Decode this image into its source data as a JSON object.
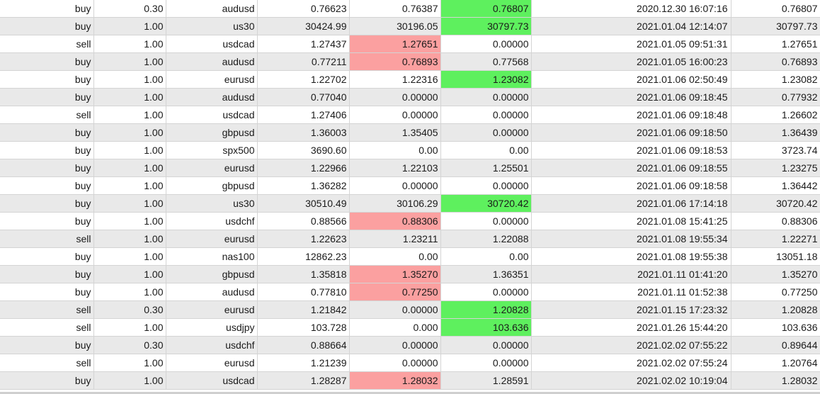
{
  "colors": {
    "stop_loss_hit": "#fba0a0",
    "take_profit_hit": "#5ef05e",
    "row_alt": "#e9e9e9",
    "row": "#ffffff",
    "grid_line": "#d4d4d4"
  },
  "rows": [
    {
      "type": "buy",
      "volume": "0.30",
      "symbol": "audusd",
      "open_price": "0.76623",
      "stop_loss": "0.76387",
      "take_profit": "0.76807",
      "close_time": "2020.12.30 16:07:16",
      "close_price": "0.76807",
      "sl_hit": false,
      "tp_hit": true
    },
    {
      "type": "buy",
      "volume": "1.00",
      "symbol": "us30",
      "open_price": "30424.99",
      "stop_loss": "30196.05",
      "take_profit": "30797.73",
      "close_time": "2021.01.04 12:14:07",
      "close_price": "30797.73",
      "sl_hit": false,
      "tp_hit": true
    },
    {
      "type": "sell",
      "volume": "1.00",
      "symbol": "usdcad",
      "open_price": "1.27437",
      "stop_loss": "1.27651",
      "take_profit": "0.00000",
      "close_time": "2021.01.05 09:51:31",
      "close_price": "1.27651",
      "sl_hit": true,
      "tp_hit": false
    },
    {
      "type": "buy",
      "volume": "1.00",
      "symbol": "audusd",
      "open_price": "0.77211",
      "stop_loss": "0.76893",
      "take_profit": "0.77568",
      "close_time": "2021.01.05 16:00:23",
      "close_price": "0.76893",
      "sl_hit": true,
      "tp_hit": false
    },
    {
      "type": "buy",
      "volume": "1.00",
      "symbol": "eurusd",
      "open_price": "1.22702",
      "stop_loss": "1.22316",
      "take_profit": "1.23082",
      "close_time": "2021.01.06 02:50:49",
      "close_price": "1.23082",
      "sl_hit": false,
      "tp_hit": true
    },
    {
      "type": "buy",
      "volume": "1.00",
      "symbol": "audusd",
      "open_price": "0.77040",
      "stop_loss": "0.00000",
      "take_profit": "0.00000",
      "close_time": "2021.01.06 09:18:45",
      "close_price": "0.77932",
      "sl_hit": false,
      "tp_hit": false
    },
    {
      "type": "sell",
      "volume": "1.00",
      "symbol": "usdcad",
      "open_price": "1.27406",
      "stop_loss": "0.00000",
      "take_profit": "0.00000",
      "close_time": "2021.01.06 09:18:48",
      "close_price": "1.26602",
      "sl_hit": false,
      "tp_hit": false
    },
    {
      "type": "buy",
      "volume": "1.00",
      "symbol": "gbpusd",
      "open_price": "1.36003",
      "stop_loss": "1.35405",
      "take_profit": "0.00000",
      "close_time": "2021.01.06 09:18:50",
      "close_price": "1.36439",
      "sl_hit": false,
      "tp_hit": false
    },
    {
      "type": "buy",
      "volume": "1.00",
      "symbol": "spx500",
      "open_price": "3690.60",
      "stop_loss": "0.00",
      "take_profit": "0.00",
      "close_time": "2021.01.06 09:18:53",
      "close_price": "3723.74",
      "sl_hit": false,
      "tp_hit": false
    },
    {
      "type": "buy",
      "volume": "1.00",
      "symbol": "eurusd",
      "open_price": "1.22966",
      "stop_loss": "1.22103",
      "take_profit": "1.25501",
      "close_time": "2021.01.06 09:18:55",
      "close_price": "1.23275",
      "sl_hit": false,
      "tp_hit": false
    },
    {
      "type": "buy",
      "volume": "1.00",
      "symbol": "gbpusd",
      "open_price": "1.36282",
      "stop_loss": "0.00000",
      "take_profit": "0.00000",
      "close_time": "2021.01.06 09:18:58",
      "close_price": "1.36442",
      "sl_hit": false,
      "tp_hit": false
    },
    {
      "type": "buy",
      "volume": "1.00",
      "symbol": "us30",
      "open_price": "30510.49",
      "stop_loss": "30106.29",
      "take_profit": "30720.42",
      "close_time": "2021.01.06 17:14:18",
      "close_price": "30720.42",
      "sl_hit": false,
      "tp_hit": true
    },
    {
      "type": "buy",
      "volume": "1.00",
      "symbol": "usdchf",
      "open_price": "0.88566",
      "stop_loss": "0.88306",
      "take_profit": "0.00000",
      "close_time": "2021.01.08 15:41:25",
      "close_price": "0.88306",
      "sl_hit": true,
      "tp_hit": false
    },
    {
      "type": "sell",
      "volume": "1.00",
      "symbol": "eurusd",
      "open_price": "1.22623",
      "stop_loss": "1.23211",
      "take_profit": "1.22088",
      "close_time": "2021.01.08 19:55:34",
      "close_price": "1.22271",
      "sl_hit": false,
      "tp_hit": false
    },
    {
      "type": "buy",
      "volume": "1.00",
      "symbol": "nas100",
      "open_price": "12862.23",
      "stop_loss": "0.00",
      "take_profit": "0.00",
      "close_time": "2021.01.08 19:55:38",
      "close_price": "13051.18",
      "sl_hit": false,
      "tp_hit": false
    },
    {
      "type": "buy",
      "volume": "1.00",
      "symbol": "gbpusd",
      "open_price": "1.35818",
      "stop_loss": "1.35270",
      "take_profit": "1.36351",
      "close_time": "2021.01.11 01:41:20",
      "close_price": "1.35270",
      "sl_hit": true,
      "tp_hit": false
    },
    {
      "type": "buy",
      "volume": "1.00",
      "symbol": "audusd",
      "open_price": "0.77810",
      "stop_loss": "0.77250",
      "take_profit": "0.00000",
      "close_time": "2021.01.11 01:52:38",
      "close_price": "0.77250",
      "sl_hit": true,
      "tp_hit": false
    },
    {
      "type": "sell",
      "volume": "0.30",
      "symbol": "eurusd",
      "open_price": "1.21842",
      "stop_loss": "0.00000",
      "take_profit": "1.20828",
      "close_time": "2021.01.15 17:23:32",
      "close_price": "1.20828",
      "sl_hit": false,
      "tp_hit": true
    },
    {
      "type": "sell",
      "volume": "1.00",
      "symbol": "usdjpy",
      "open_price": "103.728",
      "stop_loss": "0.000",
      "take_profit": "103.636",
      "close_time": "2021.01.26 15:44:20",
      "close_price": "103.636",
      "sl_hit": false,
      "tp_hit": true
    },
    {
      "type": "buy",
      "volume": "0.30",
      "symbol": "usdchf",
      "open_price": "0.88664",
      "stop_loss": "0.00000",
      "take_profit": "0.00000",
      "close_time": "2021.02.02 07:55:22",
      "close_price": "0.89644",
      "sl_hit": false,
      "tp_hit": false
    },
    {
      "type": "sell",
      "volume": "1.00",
      "symbol": "eurusd",
      "open_price": "1.21239",
      "stop_loss": "0.00000",
      "take_profit": "0.00000",
      "close_time": "2021.02.02 07:55:24",
      "close_price": "1.20764",
      "sl_hit": false,
      "tp_hit": false
    },
    {
      "type": "buy",
      "volume": "1.00",
      "symbol": "usdcad",
      "open_price": "1.28287",
      "stop_loss": "1.28032",
      "take_profit": "1.28591",
      "close_time": "2021.02.02 10:19:04",
      "close_price": "1.28032",
      "sl_hit": true,
      "tp_hit": false
    }
  ]
}
